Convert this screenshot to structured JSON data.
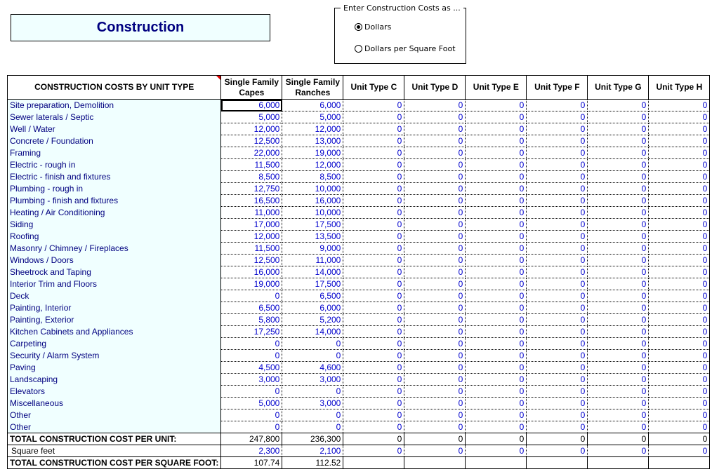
{
  "title": "Construction",
  "cost_mode": {
    "legend": "Enter Construction Costs as ...",
    "options": [
      {
        "label": "Dollars",
        "selected": true
      },
      {
        "label": "Dollars per Square Foot",
        "selected": false
      }
    ]
  },
  "table": {
    "header_label": "CONSTRUCTION COSTS BY UNIT TYPE",
    "columns": [
      "Single Family Capes",
      "Single Family Ranches",
      "Unit Type C",
      "Unit Type D",
      "Unit Type E",
      "Unit Type F",
      "Unit Type G",
      "Unit Type H"
    ],
    "rows": [
      {
        "label": "Site preparation, Demolition",
        "values": [
          "6,000",
          "6,000",
          "0",
          "0",
          "0",
          "0",
          "0",
          "0"
        ]
      },
      {
        "label": "Sewer laterals / Septic",
        "values": [
          "5,000",
          "5,000",
          "0",
          "0",
          "0",
          "0",
          "0",
          "0"
        ]
      },
      {
        "label": "Well / Water",
        "values": [
          "12,000",
          "12,000",
          "0",
          "0",
          "0",
          "0",
          "0",
          "0"
        ]
      },
      {
        "label": "Concrete / Foundation",
        "values": [
          "12,500",
          "13,000",
          "0",
          "0",
          "0",
          "0",
          "0",
          "0"
        ]
      },
      {
        "label": "Framing",
        "values": [
          "22,000",
          "19,000",
          "0",
          "0",
          "0",
          "0",
          "0",
          "0"
        ]
      },
      {
        "label": "Electric - rough in",
        "values": [
          "11,500",
          "12,000",
          "0",
          "0",
          "0",
          "0",
          "0",
          "0"
        ]
      },
      {
        "label": "Electric - finish and fixtures",
        "values": [
          "8,500",
          "8,500",
          "0",
          "0",
          "0",
          "0",
          "0",
          "0"
        ]
      },
      {
        "label": "Plumbing - rough in",
        "values": [
          "12,750",
          "10,000",
          "0",
          "0",
          "0",
          "0",
          "0",
          "0"
        ]
      },
      {
        "label": "Plumbing - finish and fixtures",
        "values": [
          "16,500",
          "16,000",
          "0",
          "0",
          "0",
          "0",
          "0",
          "0"
        ]
      },
      {
        "label": "Heating / Air Conditioning",
        "values": [
          "11,000",
          "10,000",
          "0",
          "0",
          "0",
          "0",
          "0",
          "0"
        ]
      },
      {
        "label": "Siding",
        "values": [
          "17,000",
          "17,500",
          "0",
          "0",
          "0",
          "0",
          "0",
          "0"
        ]
      },
      {
        "label": "Roofing",
        "values": [
          "12,000",
          "13,500",
          "0",
          "0",
          "0",
          "0",
          "0",
          "0"
        ]
      },
      {
        "label": "Masonry / Chimney / Fireplaces",
        "values": [
          "11,500",
          "9,000",
          "0",
          "0",
          "0",
          "0",
          "0",
          "0"
        ]
      },
      {
        "label": "Windows / Doors",
        "values": [
          "12,500",
          "11,000",
          "0",
          "0",
          "0",
          "0",
          "0",
          "0"
        ]
      },
      {
        "label": "Sheetrock and Taping",
        "values": [
          "16,000",
          "14,000",
          "0",
          "0",
          "0",
          "0",
          "0",
          "0"
        ]
      },
      {
        "label": "Interior Trim and Floors",
        "values": [
          "19,000",
          "17,500",
          "0",
          "0",
          "0",
          "0",
          "0",
          "0"
        ]
      },
      {
        "label": "Deck",
        "values": [
          "0",
          "6,500",
          "0",
          "0",
          "0",
          "0",
          "0",
          "0"
        ]
      },
      {
        "label": "Painting, Interior",
        "values": [
          "6,500",
          "6,000",
          "0",
          "0",
          "0",
          "0",
          "0",
          "0"
        ]
      },
      {
        "label": "Painting, Exterior",
        "values": [
          "5,800",
          "5,200",
          "0",
          "0",
          "0",
          "0",
          "0",
          "0"
        ]
      },
      {
        "label": "Kitchen Cabinets and Appliances",
        "values": [
          "17,250",
          "14,000",
          "0",
          "0",
          "0",
          "0",
          "0",
          "0"
        ]
      },
      {
        "label": "Carpeting",
        "values": [
          "0",
          "0",
          "0",
          "0",
          "0",
          "0",
          "0",
          "0"
        ]
      },
      {
        "label": "Security / Alarm System",
        "values": [
          "0",
          "0",
          "0",
          "0",
          "0",
          "0",
          "0",
          "0"
        ]
      },
      {
        "label": "Paving",
        "values": [
          "4,500",
          "4,600",
          "0",
          "0",
          "0",
          "0",
          "0",
          "0"
        ]
      },
      {
        "label": "Landscaping",
        "values": [
          "3,000",
          "3,000",
          "0",
          "0",
          "0",
          "0",
          "0",
          "0"
        ]
      },
      {
        "label": "Elevators",
        "values": [
          "0",
          "0",
          "0",
          "0",
          "0",
          "0",
          "0",
          "0"
        ]
      },
      {
        "label": "Miscellaneous",
        "values": [
          "5,000",
          "3,000",
          "0",
          "0",
          "0",
          "0",
          "0",
          "0"
        ]
      },
      {
        "label": "Other",
        "values": [
          "0",
          "0",
          "0",
          "0",
          "0",
          "0",
          "0",
          "0"
        ]
      },
      {
        "label": "Other",
        "values": [
          "0",
          "0",
          "0",
          "0",
          "0",
          "0",
          "0",
          "0"
        ]
      }
    ],
    "total_per_unit": {
      "label": "TOTAL CONSTRUCTION COST PER UNIT:",
      "values": [
        "247,800",
        "236,300",
        "0",
        "0",
        "0",
        "0",
        "0",
        "0"
      ]
    },
    "square_feet": {
      "label": "Square feet",
      "values": [
        "2,300",
        "2,100",
        "0",
        "0",
        "0",
        "0",
        "0",
        "0"
      ]
    },
    "total_per_sqft": {
      "label": "TOTAL CONSTRUCTION COST PER SQUARE FOOT:",
      "values": [
        "107.74",
        "112.52",
        "",
        "",
        "",
        "",
        "",
        ""
      ]
    }
  }
}
